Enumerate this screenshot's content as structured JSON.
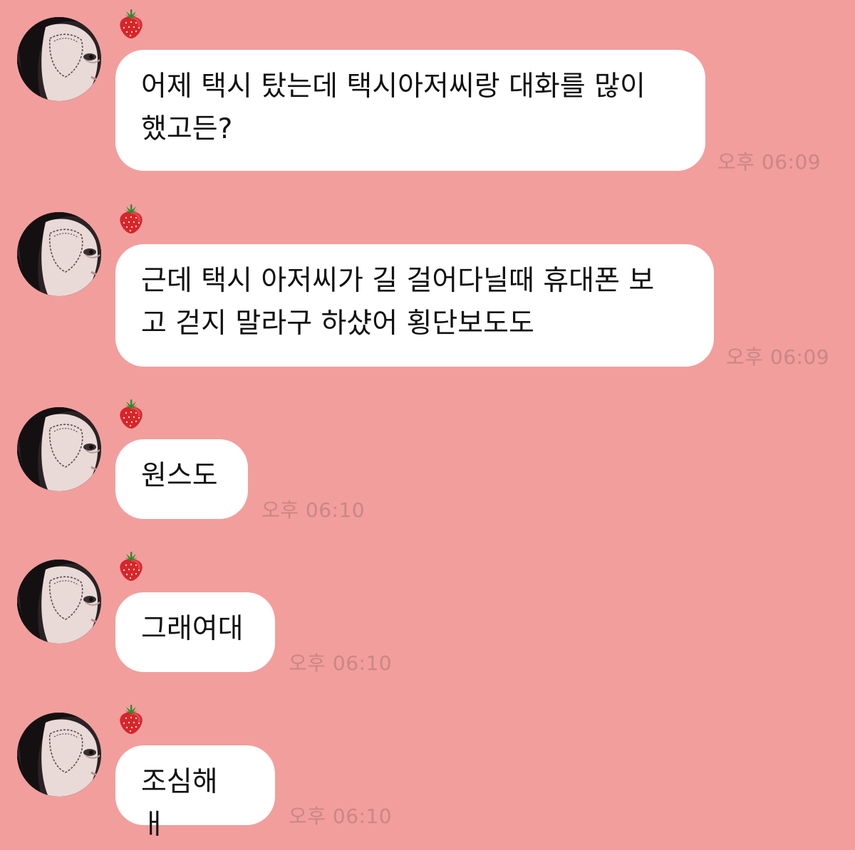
{
  "conversation": {
    "sender_marker_icon": "strawberry-icon",
    "avatar_icon": "profile-photo-avatar",
    "colors": {
      "background": "#f29e9d",
      "bubble": "#ffffff",
      "timestamp": "#c98784",
      "text": "#111111"
    },
    "messages": [
      {
        "text": "어제 택시 탔는데 택시아저씨랑 대화를 많이\n했고든?",
        "time": "오후 06:09"
      },
      {
        "text": "근데 택시 아저씨가 길 걸어다닐때 휴대폰 보\n고 걷지 말라구 하샸어 횡단보도도",
        "time": "오후 06:09"
      },
      {
        "text": "원스도",
        "time": "오후 06:10"
      },
      {
        "text": "그래여대",
        "time": "오후 06:10"
      },
      {
        "text": "조심해 ㅐ",
        "time": "오후 06:10"
      }
    ]
  }
}
